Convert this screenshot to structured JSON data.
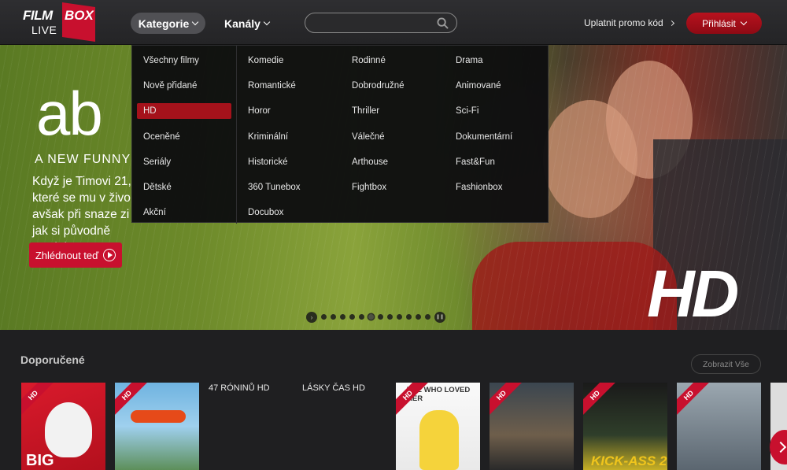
{
  "header": {
    "logo": {
      "film": "FILM",
      "box": "BOX",
      "live": "LIVE"
    },
    "nav": {
      "categories_label": "Kategorie",
      "channels_label": "Kanály"
    },
    "search": {
      "placeholder": "",
      "value": ""
    },
    "promo_label": "Uplatnit promo kód",
    "login_label": "Přihlásit"
  },
  "hero": {
    "title": "ab",
    "tagline": "A NEW FUNNY",
    "text": "Když je Timovi 21, které se mu v živo avšak při snaze zi jak si původně myslel.",
    "watch_label": "Zhlédnout teď",
    "badge": "HD",
    "slider": {
      "count": 12,
      "active_index": 5
    }
  },
  "dropdown": {
    "left": [
      "Všechny filmy",
      "Nově přidané",
      "HD",
      "Oceněné",
      "Seriály",
      "Dětské",
      "Akční"
    ],
    "active": "HD",
    "col1": [
      "Komedie",
      "Romantické",
      "Horor",
      "Kriminální",
      "Historické",
      "360 Tunebox",
      "Docubox"
    ],
    "col2": [
      "Rodinné",
      "Dobrodružné",
      "Thriller",
      "Válečné",
      "Arthouse",
      "Fightbox"
    ],
    "col3": [
      "Drama",
      "Animované",
      "Sci-Fi",
      "Dokumentární",
      "Fast&Fun",
      "Fashionbox"
    ]
  },
  "recommended": {
    "title": "Doporučené",
    "show_all": "Zobrazit Vše",
    "badge": "HD",
    "text_titles": [
      "47 RÓNINŮ HD",
      "LÁSKY ČAS HD"
    ],
    "poster_texts": {
      "big": "BIG",
      "minion": "THE WHO LOVED HER",
      "kick": "KICK-ASS 2"
    }
  },
  "colors": {
    "accent": "#c8102e",
    "header_bg": "#2a2a2c",
    "dropdown_bg": "#0e0e10",
    "page_bg": "#1f1f21"
  }
}
